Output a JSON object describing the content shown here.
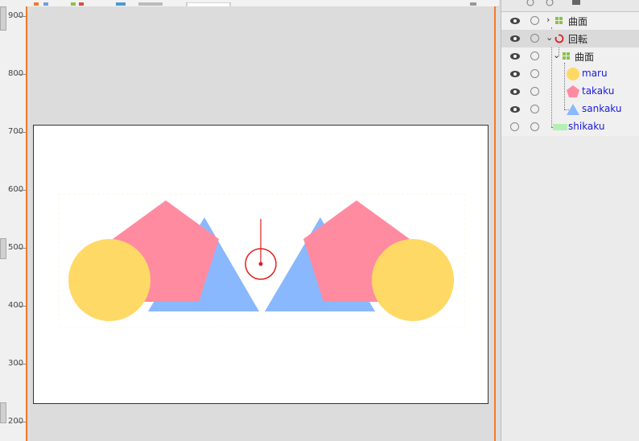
{
  "ruler": {
    "ticks": [
      "900",
      "800",
      "700",
      "600",
      "500",
      "400",
      "300",
      "200"
    ]
  },
  "layers": [
    {
      "label": "曲面",
      "type": "group",
      "icon": "group-icon",
      "expanded": false
    },
    {
      "label": "回転",
      "type": "rotation",
      "icon": "rotate-icon",
      "expanded": true,
      "selected": true
    },
    {
      "label": "曲面",
      "type": "group",
      "icon": "group-icon",
      "expanded": true
    },
    {
      "label": "maru",
      "type": "circle",
      "icon": "circle-shape-icon",
      "color": "#ffd966"
    },
    {
      "label": "takaku",
      "type": "polygon",
      "icon": "pentagon-shape-icon",
      "color": "#ff8ba0"
    },
    {
      "label": "sankaku",
      "type": "triangle",
      "icon": "triangle-shape-icon",
      "color": "#8ab8ff"
    },
    {
      "label": "shikaku",
      "type": "rectangle",
      "icon": "rectangle-shape-icon",
      "color": "#b4f0b4"
    }
  ],
  "colors": {
    "accent": "#f07a2a",
    "circle": "#ffd966",
    "pentagon": "#ff8ba0",
    "triangle": "#8ab8ff",
    "rectangle": "#b4f0b4",
    "rotation": "#e02020"
  }
}
